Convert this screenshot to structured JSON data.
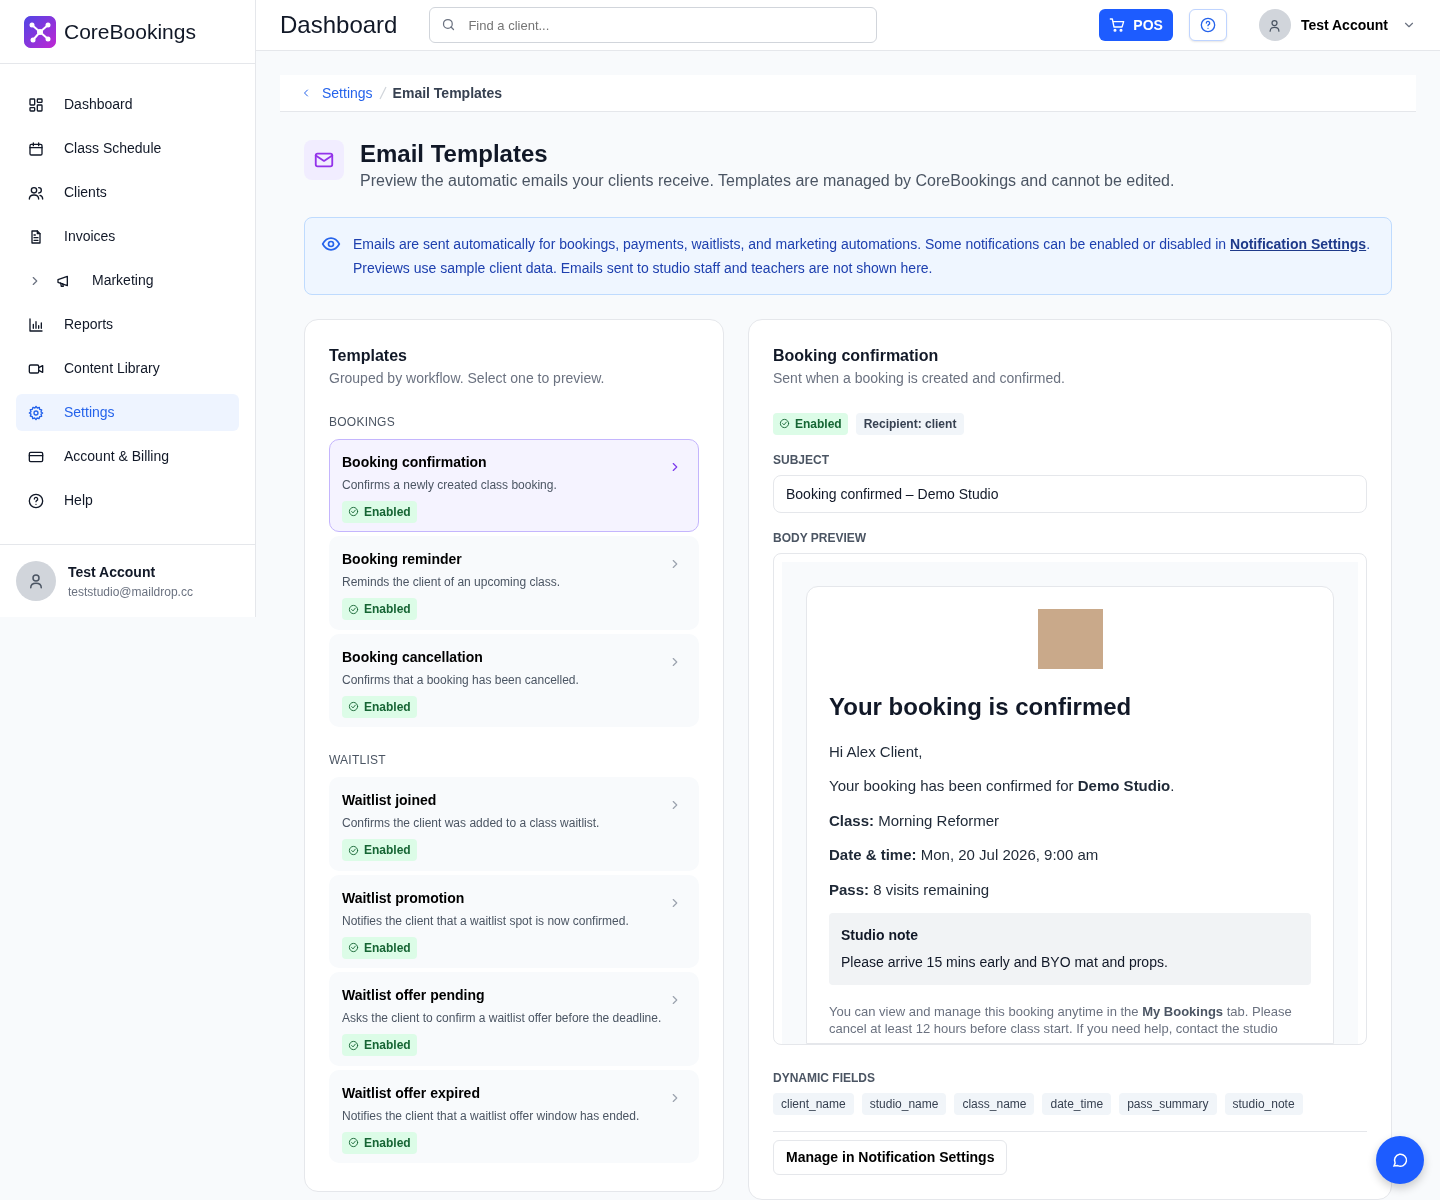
{
  "brand": {
    "name": "CoreBookings"
  },
  "sidebar": {
    "items": [
      {
        "label": "Dashboard",
        "selected": false
      },
      {
        "label": "Class Schedule",
        "selected": false
      },
      {
        "label": "Clients",
        "selected": false
      },
      {
        "label": "Invoices",
        "selected": false
      },
      {
        "label": "Marketing",
        "selected": false,
        "expanded": false
      },
      {
        "label": "Reports",
        "selected": false
      },
      {
        "label": "Content Library",
        "selected": false
      },
      {
        "label": "Settings",
        "selected": true
      },
      {
        "label": "Account & Billing",
        "selected": false
      },
      {
        "label": "Help",
        "selected": false
      }
    ],
    "user": {
      "name": "Test Account",
      "email": "teststudio@maildrop.cc"
    }
  },
  "topbar": {
    "title": "Dashboard",
    "search": {
      "placeholder": "Find a client..."
    },
    "pos_button": "POS",
    "account": "Test Account"
  },
  "breadcrumb": [
    {
      "label": "Settings"
    },
    {
      "label": "Email Templates"
    }
  ],
  "page": {
    "title": "Email Templates",
    "subtitle": "Preview the automatic emails your clients receive. Templates are managed by CoreBookings and cannot be edited."
  },
  "info": {
    "text_before": "Emails are sent automatically for bookings, payments, waitlists, and marketing automations. Some notifications can be enabled or disabled in ",
    "link": "Notification Settings",
    "text_after": ". Previews use sample client data. Emails sent to studio staff and teachers are not shown here."
  },
  "templates": {
    "title": "Templates",
    "subtitle": "Grouped by workflow. Select one to preview.",
    "groups": [
      {
        "label": "BOOKINGS",
        "items": [
          {
            "title": "Booking confirmation",
            "description": "Confirms a newly created class booking.",
            "status": "Enabled",
            "enabled": true,
            "selected": true
          },
          {
            "title": "Booking reminder",
            "description": "Reminds the client of an upcoming class.",
            "status": "Enabled",
            "enabled": true,
            "selected": false
          },
          {
            "title": "Booking cancellation",
            "description": "Confirms that a booking has been cancelled.",
            "status": "Enabled",
            "enabled": true,
            "selected": false
          }
        ]
      },
      {
        "label": "WAITLIST",
        "items": [
          {
            "title": "Waitlist joined",
            "description": "Confirms the client was added to a class waitlist.",
            "status": "Enabled",
            "enabled": true,
            "selected": false
          },
          {
            "title": "Waitlist promotion",
            "description": "Notifies the client that a waitlist spot is now confirmed.",
            "status": "Enabled",
            "enabled": true,
            "selected": false
          },
          {
            "title": "Waitlist offer pending",
            "description": "Asks the client to confirm a waitlist offer before the deadline.",
            "status": "Enabled",
            "enabled": true,
            "selected": false
          },
          {
            "title": "Waitlist offer expired",
            "description": "Notifies the client that a waitlist offer window has ended.",
            "status": "Enabled",
            "enabled": true,
            "selected": false
          }
        ]
      }
    ]
  },
  "detail": {
    "title": "Booking confirmation",
    "subtitle": "Sent when a booking is created and confirmed.",
    "status": "Enabled",
    "enabled": true,
    "recipient": "Recipient: client",
    "subject_label": "SUBJECT",
    "subject": "Booking confirmed – Demo Studio",
    "body_label": "BODY PREVIEW",
    "email": {
      "heading": "Your booking is confirmed",
      "paragraphs": [
        "Hi Alex Client,",
        "Your booking has been confirmed for **Demo Studio**.",
        "**Class:** Morning Reformer",
        "**Date & time:** Mon, 20 Jul 2026, 9:00 am",
        "**Pass:** 8 visits remaining"
      ],
      "note": {
        "title": "Studio note",
        "text": "Please arrive 15 mins early and BYO mat and props."
      },
      "footer": "You can view and manage this booking anytime in the **My Bookings** tab. Please cancel at least 12 hours before class start. If you need help, contact the studio"
    },
    "fields_label": "DYNAMIC FIELDS",
    "fields": [
      "client_name",
      "studio_name",
      "class_name",
      "date_time",
      "pass_summary",
      "studio_note"
    ],
    "manage_button": "Manage in Notification Settings"
  }
}
